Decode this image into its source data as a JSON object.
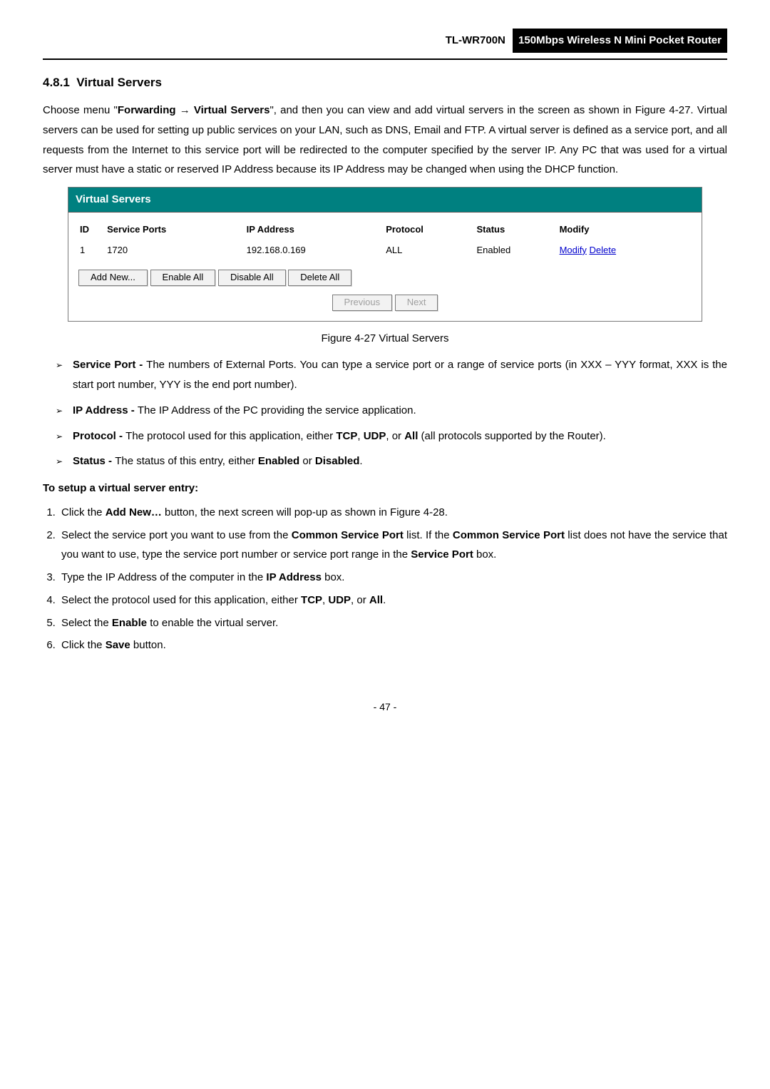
{
  "header": {
    "model": "TL-WR700N",
    "desc": "150Mbps Wireless N Mini Pocket Router"
  },
  "section": {
    "number": "4.8.1",
    "title": "Virtual Servers"
  },
  "intro": {
    "p1a": "Choose menu \"",
    "p1b": "Forwarding  →  Virtual Servers",
    "p1c": "\", and then you can view and add virtual servers in the screen as shown in Figure 4-27. Virtual servers can be used for setting up public services on your LAN, such as DNS, Email and FTP. A virtual server is defined as a service port, and all requests from the Internet to this service port will be redirected to the computer specified by the server IP. Any PC that was used for a virtual server must have a static or reserved IP Address because its IP Address may be changed when using the DHCP function."
  },
  "figure": {
    "title": "Virtual Servers",
    "headers": {
      "id": "ID",
      "ports": "Service Ports",
      "ip": "IP Address",
      "proto": "Protocol",
      "status": "Status",
      "modify": "Modify"
    },
    "row": {
      "id": "1",
      "ports": "1720",
      "ip": "192.168.0.169",
      "proto": "ALL",
      "status": "Enabled",
      "modify_link": "Modify",
      "delete_link": "Delete"
    },
    "buttons": {
      "add": "Add New...",
      "enable": "Enable All",
      "disable": "Disable All",
      "delete": "Delete All",
      "prev": "Previous",
      "next": "Next"
    },
    "caption": "Figure 4-27   Virtual Servers"
  },
  "defs": {
    "sp_label": "Service Port - ",
    "sp_text": "The numbers of External Ports. You can type a service port or a range of service ports (in XXX – YYY format, XXX is the start port number, YYY is the end port number).",
    "ip_label": "IP Address - ",
    "ip_text": "The IP Address of the PC providing the service application.",
    "proto_label": "Protocol - ",
    "proto_a": "The protocol used for this application, either ",
    "proto_tcp": "TCP",
    "proto_b": ", ",
    "proto_udp": "UDP",
    "proto_c": ", or ",
    "proto_all": "All",
    "proto_d": " (all protocols supported by the Router).",
    "status_label": "Status - ",
    "status_a": "The status of this entry, either ",
    "status_en": "Enabled",
    "status_b": " or ",
    "status_dis": "Disabled",
    "status_c": "."
  },
  "setup": {
    "title": "To setup a virtual server entry:",
    "s1a": "Click the ",
    "s1b": "Add New…",
    "s1c": " button, the next screen will pop-up as shown in Figure 4-28.",
    "s2a": "Select the service port you want to use from the ",
    "s2b": "Common Service Port",
    "s2c": " list. If the ",
    "s2d": "Common Service Port",
    "s2e": " list does not have the service that you want to use, type the service port number or service port range in the ",
    "s2f": "Service Port",
    "s2g": " box.",
    "s3a": "Type the IP Address of the computer in the ",
    "s3b": "IP Address",
    "s3c": " box.",
    "s4a": "Select the protocol used for this application, either ",
    "s4b": "TCP",
    "s4c": ", ",
    "s4d": "UDP",
    "s4e": ", or ",
    "s4f": "All",
    "s4g": ".",
    "s5a": "Select the ",
    "s5b": "Enable",
    "s5c": " to enable the virtual server.",
    "s6a": "Click the ",
    "s6b": "Save",
    "s6c": " button."
  },
  "footer": {
    "page": "- 47 -"
  }
}
